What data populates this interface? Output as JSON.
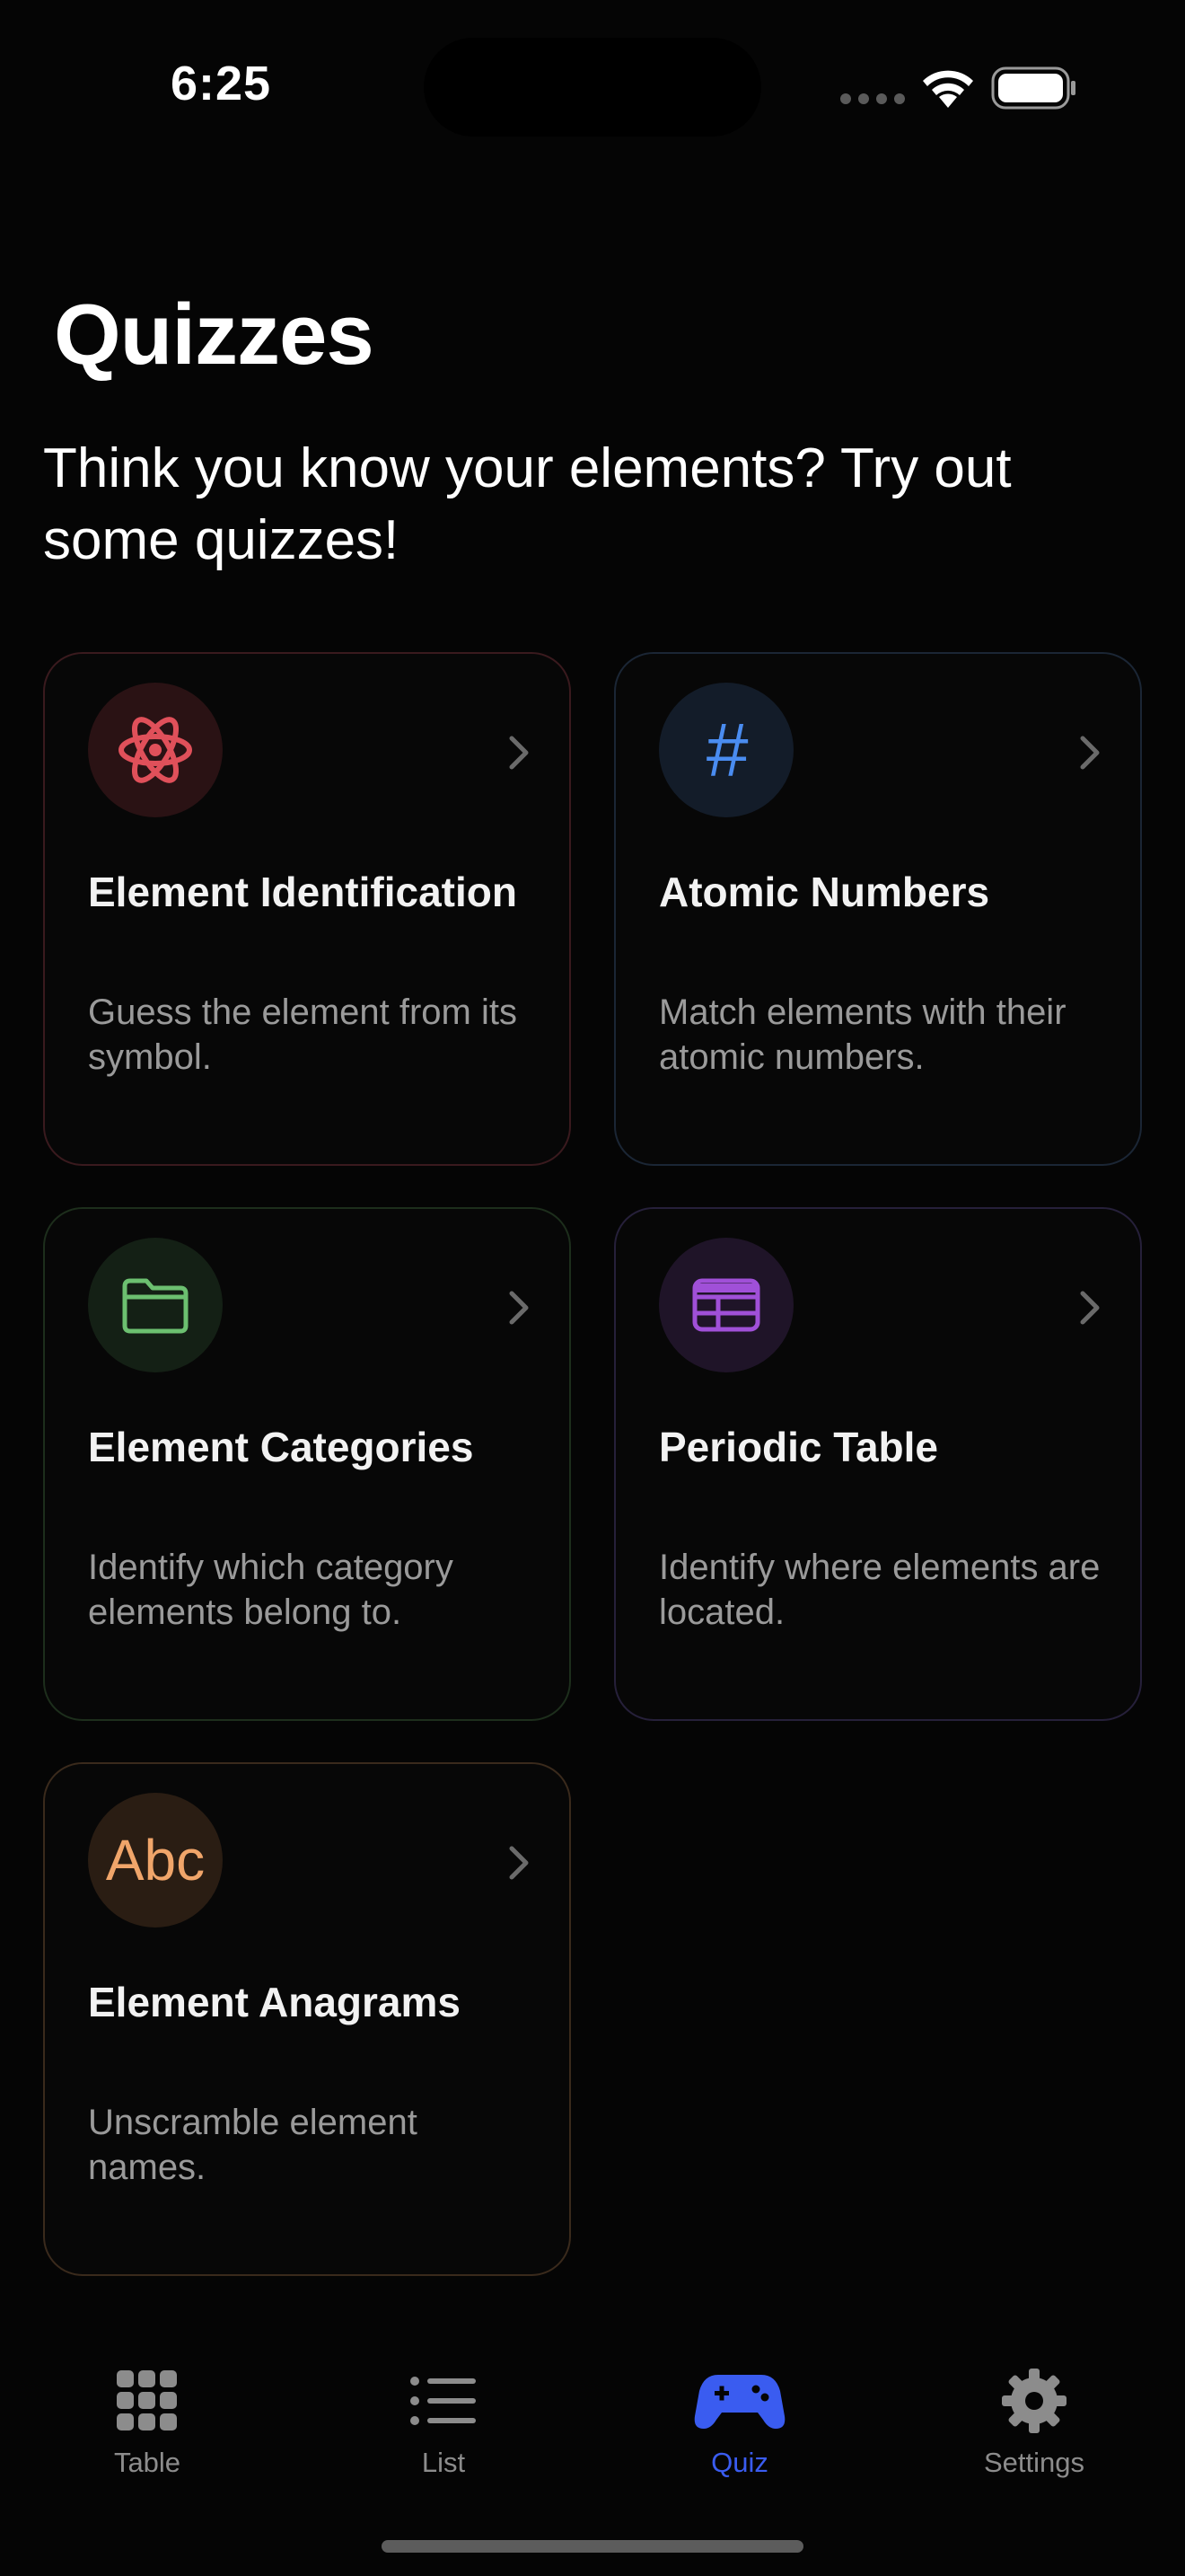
{
  "status_bar": {
    "time": "6:25"
  },
  "header": {
    "title": "Quizzes",
    "subtitle": "Think you know your elements? Try out some quizzes!"
  },
  "quizzes": [
    {
      "title": "Element Identification",
      "description": "Guess the element from its symbol.",
      "icon": "atom-icon",
      "accent": "#e0505a"
    },
    {
      "title": "Atomic Numbers",
      "description": "Match elements with their atomic numbers.",
      "icon": "number-sign-icon",
      "icon_glyph": "#",
      "accent": "#4a8cf0"
    },
    {
      "title": "Element Categories",
      "description": "Identify which category elements belong to.",
      "icon": "folder-icon",
      "accent": "#6cc070"
    },
    {
      "title": "Periodic Table",
      "description": "Identify where elements are located.",
      "icon": "table-grid-icon",
      "accent": "#a050d8"
    },
    {
      "title": "Element Anagrams",
      "description": "Unscramble element names.",
      "icon": "abc-text-icon",
      "icon_glyph": "Abc",
      "accent": "#f0a56a"
    }
  ],
  "tab_bar": {
    "tabs": [
      {
        "label": "Table",
        "icon": "grid-icon"
      },
      {
        "label": "List",
        "icon": "list-icon"
      },
      {
        "label": "Quiz",
        "icon": "gamecontroller-icon",
        "active": true
      },
      {
        "label": "Settings",
        "icon": "gear-icon"
      }
    ],
    "active_color": "#3a5cf0",
    "inactive_color": "#8c8c8c"
  }
}
